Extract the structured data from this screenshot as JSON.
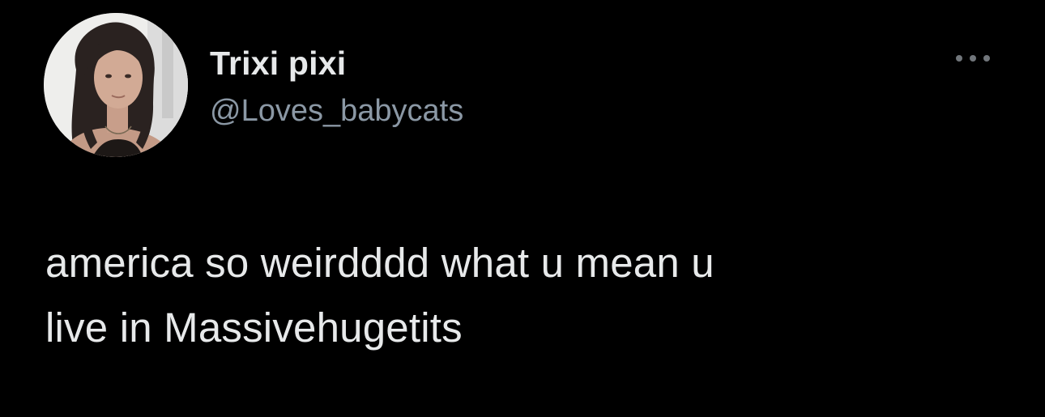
{
  "tweet": {
    "author": {
      "display_name": "Trixi pixi",
      "handle": "@Loves_babycats",
      "avatar_icon": "user-avatar-photo"
    },
    "more_icon": "more-options-icon",
    "text_lines": [
      "america so weirdddd what u mean u",
      "live in Massivehugetits"
    ]
  },
  "colors": {
    "background": "#000000",
    "primary_text": "#e7e9ea",
    "secondary_text": "#8b98a5"
  }
}
